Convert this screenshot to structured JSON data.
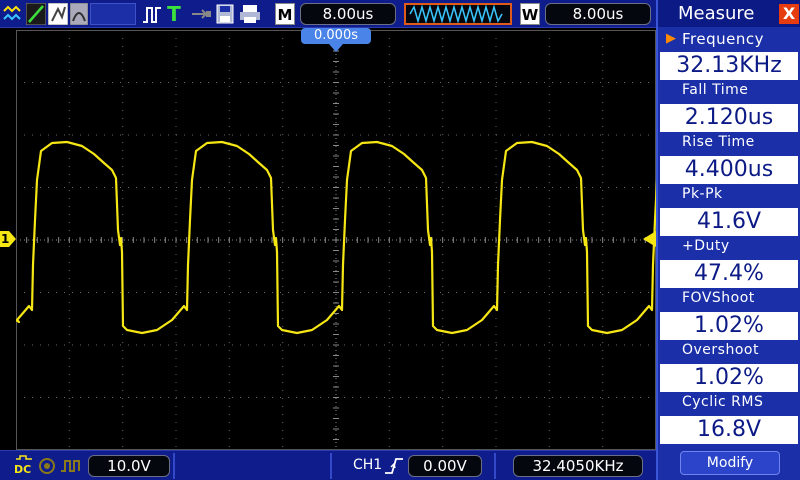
{
  "toolbar": {
    "main_timebase_label": "M",
    "main_timebase": "8.00us",
    "window_label": "W",
    "window_timebase": "8.00us",
    "trigger_position": "0.000s",
    "icons": [
      "waveform-icon",
      "ch1-probe-icon",
      "ch2-probe-icon",
      "run-mode-icon",
      "trigger-t-icon",
      "usb-icon",
      "save-icon",
      "print-icon"
    ]
  },
  "bottom": {
    "ch1_scale": "10.0V",
    "trigger_channel": "CH1",
    "trigger_level": "0.00V",
    "trigger_frequency": "32.4050KHz",
    "coupling_label": "DC"
  },
  "screen": {
    "channel_marker": "1",
    "trace_color": "#f5e614"
  },
  "measure": {
    "title": "Measure",
    "close_symbol": "X",
    "items": [
      {
        "label": "Frequency",
        "value": "32.13KHz",
        "selected": true
      },
      {
        "label": "Fall Time",
        "value": "2.120us"
      },
      {
        "label": "Rise Time",
        "value": "4.400us"
      },
      {
        "label": "Pk-Pk",
        "value": "41.6V"
      },
      {
        "label": "+Duty",
        "value": "47.4%"
      },
      {
        "label": "FOVShoot",
        "value": "1.02%"
      },
      {
        "label": "Overshoot",
        "value": "1.02%"
      },
      {
        "label": "Cyclic RMS",
        "value": "16.8V"
      }
    ],
    "modify_label": "Modify"
  }
}
